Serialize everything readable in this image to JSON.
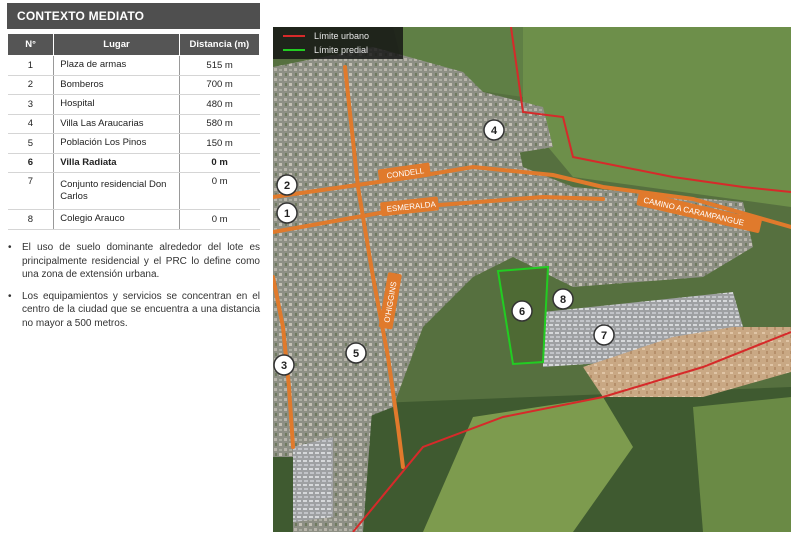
{
  "header": {
    "title": "CONTEXTO MEDIATO"
  },
  "table": {
    "headers": [
      "N°",
      "Lugar",
      "Distancia (m)"
    ],
    "rows": [
      {
        "n": "1",
        "place": "Plaza de armas",
        "distance": "515 m"
      },
      {
        "n": "2",
        "place": "Bomberos",
        "distance": "700 m"
      },
      {
        "n": "3",
        "place": "Hospital",
        "distance": "480 m"
      },
      {
        "n": "4",
        "place": "Villa Las Araucarias",
        "distance": "580 m"
      },
      {
        "n": "5",
        "place": "Población Los Pinos",
        "distance": "150 m"
      },
      {
        "n": "6",
        "place": "Villa Radiata",
        "distance": "0 m"
      },
      {
        "n": "7",
        "place": "Conjunto residencial Don Carlos",
        "distance": "0 m"
      },
      {
        "n": "8",
        "place": "Colegio Arauco",
        "distance": "0 m"
      }
    ]
  },
  "bullets": [
    "El uso de suelo dominante alrededor del lote es principalmente residencial y el PRC lo define como una zona de extensión urbana.",
    "Los equipamientos y servicios se concentran en el centro de la ciudad que se encuentra a una distancia no mayor a 500 metros."
  ],
  "map": {
    "legend": {
      "urban_label": "Límite urbano",
      "urban_color": "#d62a2a",
      "predial_label": "Límite predial",
      "predial_color": "#22cc22"
    },
    "streets": {
      "condell": "CONDELL",
      "esmeralda": "ESMERALDA",
      "ohiggins": "O'HIGGINS",
      "carampangue": "CAMINO A CARAMPANGUE"
    },
    "markers": [
      "1",
      "2",
      "3",
      "4",
      "5",
      "6",
      "7",
      "8"
    ],
    "road_color": "#e07a2c"
  }
}
